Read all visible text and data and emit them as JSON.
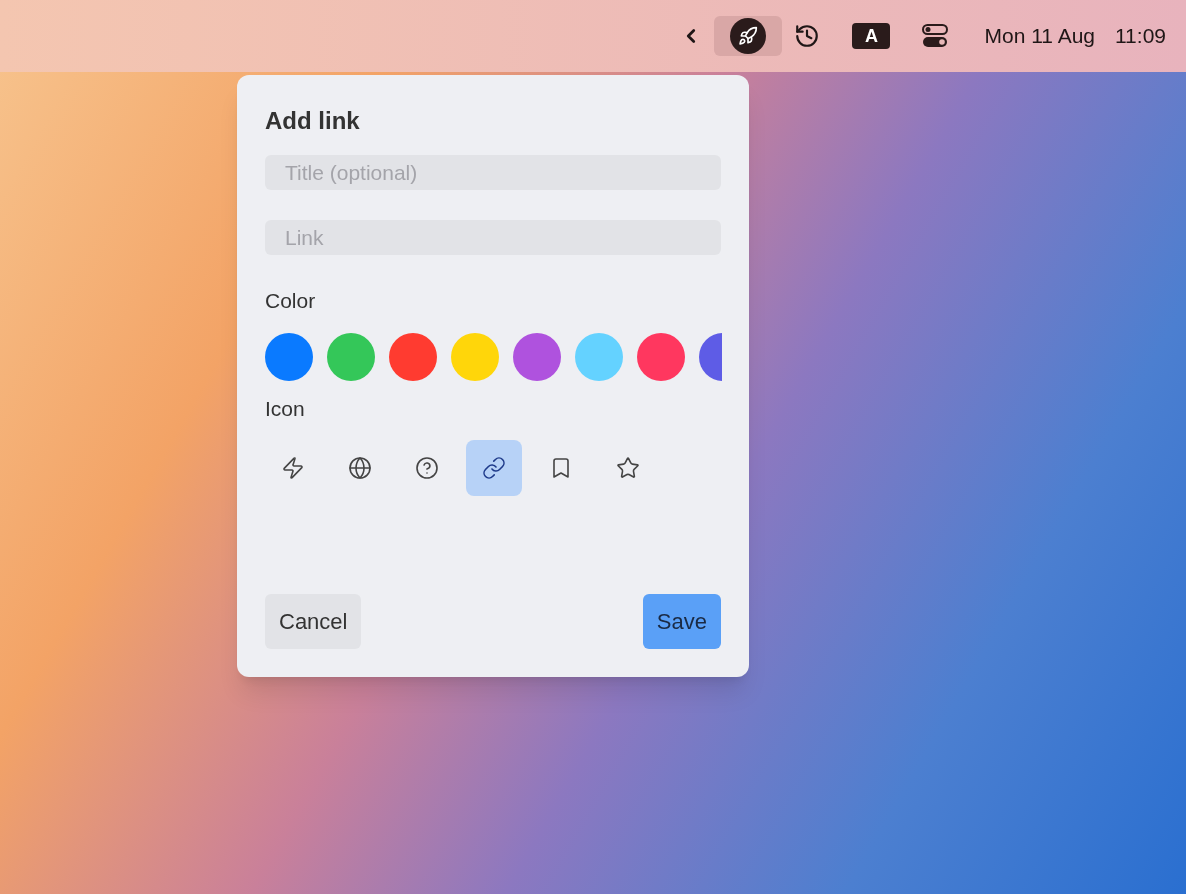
{
  "menu_bar": {
    "items": [
      {
        "kind": "chevron",
        "selected": false
      },
      {
        "kind": "rocket",
        "selected": true
      },
      {
        "kind": "history",
        "selected": false
      },
      {
        "kind": "input",
        "label": "A",
        "selected": false
      },
      {
        "kind": "controls",
        "selected": false
      }
    ],
    "date": "Mon 11 Aug",
    "time": "11:09"
  },
  "dialog": {
    "title": "Add link",
    "fields": [
      {
        "placeholder": "Title (optional)"
      },
      {
        "placeholder": "Link"
      }
    ],
    "color_label": "Color",
    "colors": [
      {
        "color": "#0a7aff"
      },
      {
        "color": "#34c759"
      },
      {
        "color": "#ff3b30"
      },
      {
        "color": "#ffd60a"
      },
      {
        "color": "#af52de"
      },
      {
        "color": "#64d2ff"
      },
      {
        "color": "#ff375f"
      },
      {
        "color": "#5e5ce6"
      }
    ],
    "icon_label": "Icon",
    "icons": [
      {
        "kind": "bolt",
        "selected": false
      },
      {
        "kind": "globe",
        "selected": false
      },
      {
        "kind": "help",
        "selected": false
      },
      {
        "kind": "link",
        "selected": true
      },
      {
        "kind": "bookmark",
        "selected": false
      },
      {
        "kind": "star",
        "selected": false
      }
    ],
    "buttons": [
      {
        "kind": "cancel",
        "label": "Cancel"
      },
      {
        "kind": "save",
        "label": "Save"
      }
    ]
  }
}
